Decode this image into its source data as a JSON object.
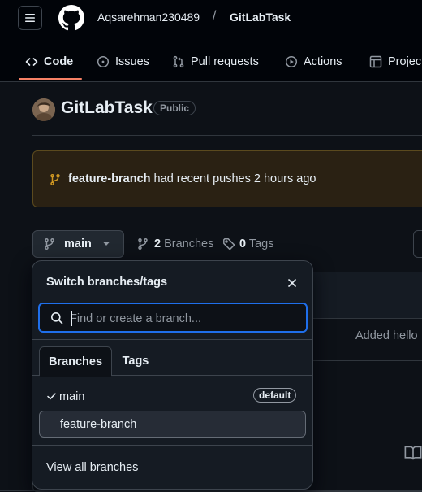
{
  "header": {
    "owner": "Aqsarehman230489",
    "separator": "/",
    "repo": "GitLabTask"
  },
  "tabs": [
    {
      "label": "Code",
      "icon": "code-icon"
    },
    {
      "label": "Issues",
      "icon": "issue-opened-icon"
    },
    {
      "label": "Pull requests",
      "icon": "git-pull-request-icon"
    },
    {
      "label": "Actions",
      "icon": "play-icon"
    },
    {
      "label": "Projec",
      "icon": "table-icon"
    }
  ],
  "repo": {
    "title": "GitLabTask",
    "visibility": "Public"
  },
  "banner": {
    "branch": "feature-branch",
    "message": " had recent pushes 2 hours ago"
  },
  "branch_bar": {
    "current_branch": "main",
    "branch_count": "2",
    "branches_label": "Branches",
    "tag_count": "0",
    "tags_label": "Tags"
  },
  "background": {
    "commit_message": "Added hello"
  },
  "dropdown": {
    "title": "Switch branches/tags",
    "search_placeholder": "Find or create a branch...",
    "tabs": [
      "Branches",
      "Tags"
    ],
    "items": [
      {
        "name": "main",
        "badge": "default",
        "selected": true
      },
      {
        "name": "feature-branch",
        "badge": "",
        "selected": false
      }
    ],
    "footer": "View all branches"
  },
  "colors": {
    "background": "#0d1117",
    "header": "#010409",
    "accent_underline": "#f78166",
    "focus_ring": "#1f6feb",
    "banner_bg": "#2a2113",
    "banner_icon": "#d29922"
  }
}
